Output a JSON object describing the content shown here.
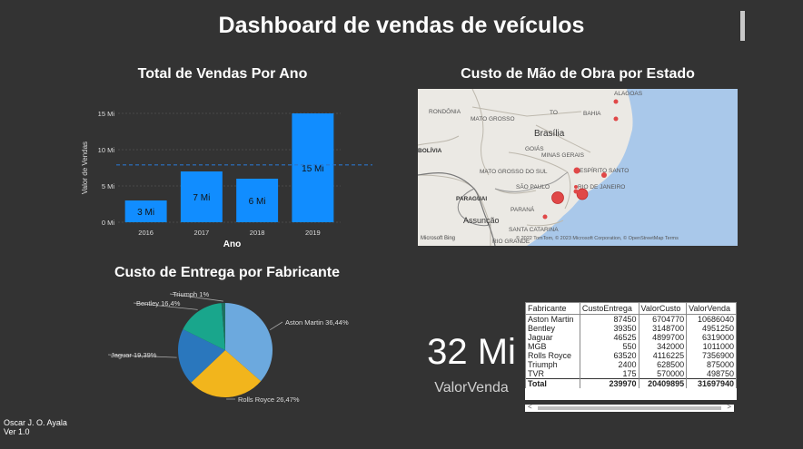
{
  "dashboard": {
    "title": "Dashboard de vendas de veículos"
  },
  "bar_chart": {
    "title": "Total de Vendas Por Ano"
  },
  "map": {
    "title": "Custo de Mão de Obra por Estado",
    "labels": {
      "rondonia": "RONDÔNIA",
      "mato_grosso": "MATO GROSSO",
      "bolivia": "BOLÍVIA",
      "brasilia": "Brasília",
      "goias": "GOIÁS",
      "minas": "MINAS GERAIS",
      "es": "ESPÍRITO SANTO",
      "ms": "MATO GROSSO DO SUL",
      "sp": "SÃO PAULO",
      "paraguai": "PARAGUAI",
      "rj": "RIO DE JANEIRO",
      "parana": "PARANÁ",
      "assuncao": "Assunção",
      "sc": "SANTA CATARINA",
      "rs": "RIO GRANDE",
      "alagoas": "ALAGOAS",
      "to": "TO",
      "bahia": "BAHIA"
    },
    "bing": "Microsoft Bing",
    "copyright": "© 2022 TomTom, © 2023 Microsoft Corporation, © OpenStreetMap  Terms"
  },
  "pie_chart": {
    "title": "Custo de Entrega por Fabricante"
  },
  "chart_data": [
    {
      "type": "bar",
      "title": "Total de Vendas Por Ano",
      "xlabel": "Ano",
      "ylabel": "Valor de Vendas",
      "categories": [
        "2016",
        "2017",
        "2018",
        "2019"
      ],
      "values": [
        3,
        7,
        6,
        15
      ],
      "data_labels": [
        "3 Mi",
        "7 Mi",
        "6 Mi",
        "15 Mi"
      ],
      "ylim": [
        0,
        15
      ],
      "yticks": [
        0,
        5,
        10,
        15
      ],
      "ytick_labels": [
        "0 Mi",
        "5 Mi",
        "10 Mi",
        "15 Mi"
      ],
      "average_line": 7.9,
      "color": "#118DFF"
    },
    {
      "type": "pie",
      "title": "Custo de Entrega por Fabricante",
      "slices": [
        {
          "label": "Aston Martin 36,44%",
          "value": 36.44,
          "color": "#6CA9DE"
        },
        {
          "label": "Rolls Royce 26,47%",
          "value": 26.47,
          "color": "#F2B51C"
        },
        {
          "label": "Jaguar 19,39%",
          "value": 19.39,
          "color": "#2A77BD"
        },
        {
          "label": "Bentley 16,4%",
          "value": 16.4,
          "color": "#19A68C"
        },
        {
          "label": "Triumph 1%",
          "value": 1.3,
          "color": "#1E6F5F"
        }
      ]
    }
  ],
  "kpi": {
    "value": "32 Mi",
    "label": "ValorVenda"
  },
  "table": {
    "headers": [
      "Fabricante",
      "CustoEntrega",
      "ValorCusto",
      "ValorVenda"
    ],
    "rows": [
      [
        "Aston Martin",
        "87450",
        "6704770",
        "10686040"
      ],
      [
        "Bentley",
        "39350",
        "3148700",
        "4951250"
      ],
      [
        "Jaguar",
        "46525",
        "4899700",
        "6319000"
      ],
      [
        "MGB",
        "550",
        "342000",
        "1011000"
      ],
      [
        "Rolls Royce",
        "63520",
        "4116225",
        "7356900"
      ],
      [
        "Triumph",
        "2400",
        "628500",
        "875000"
      ],
      [
        "TVR",
        "175",
        "570000",
        "498750"
      ]
    ],
    "total": [
      "Total",
      "239970",
      "20409895",
      "31697940"
    ]
  },
  "footer": {
    "author": "Oscar J. O. Ayala",
    "version": "Ver 1.0"
  }
}
